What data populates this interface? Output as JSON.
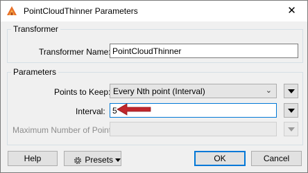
{
  "window": {
    "title": "PointCloudThinner Parameters",
    "close_glyph": "✕",
    "icon": "fme-app-icon"
  },
  "transformer_group": {
    "legend": "Transformer",
    "name_label": "Transformer Name:",
    "name_value": "PointCloudThinner"
  },
  "parameters_group": {
    "legend": "Parameters",
    "points_to_keep_label": "Points to Keep:",
    "points_to_keep_value": "Every Nth point (Interval)",
    "interval_label": "Interval:",
    "interval_value": "5",
    "max_points_label": "Maximum Number of Points:",
    "max_points_value": ""
  },
  "footer": {
    "help_label": "Help",
    "presets_label": "Presets",
    "ok_label": "OK",
    "cancel_label": "Cancel"
  },
  "annotation": {
    "arrow_color": "#c0262c",
    "icon": "red-arrow-icon"
  },
  "colors": {
    "dialog_bg": "#f0f0f0",
    "focus_border": "#0078d7"
  }
}
